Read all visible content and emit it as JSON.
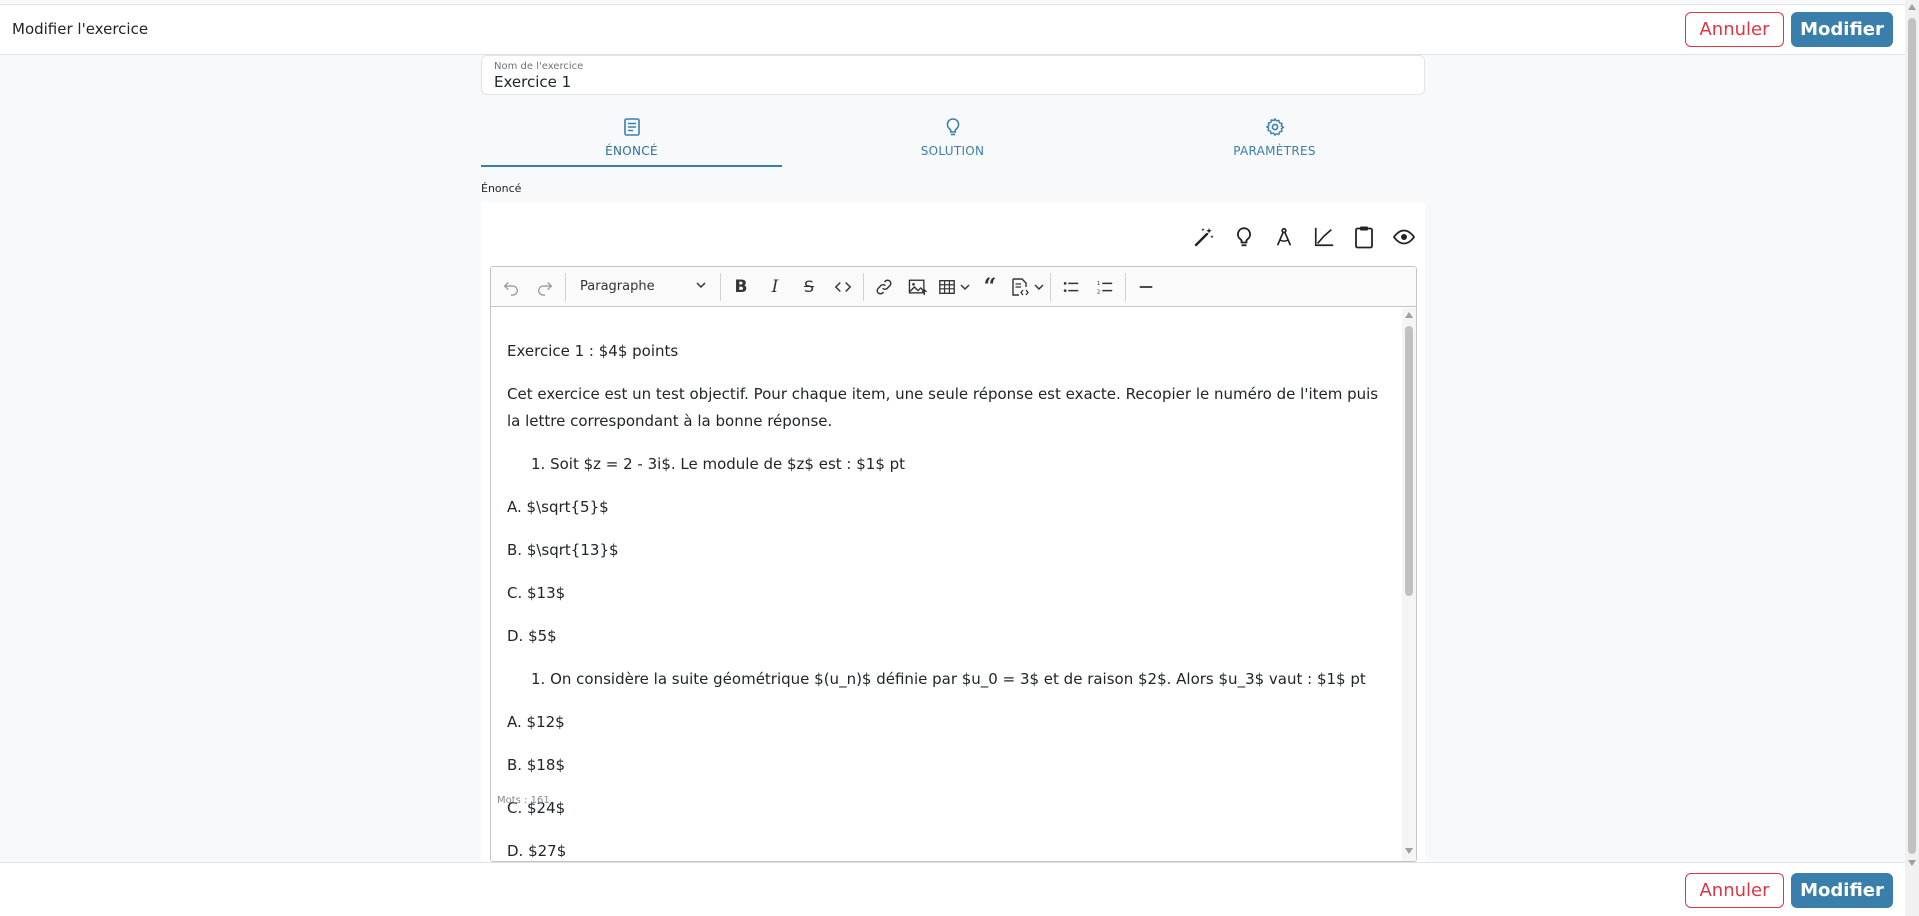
{
  "header": {
    "title": "Modifier l'exercice",
    "cancel_label": "Annuler",
    "submit_label": "Modifier"
  },
  "name_field": {
    "label": "Nom de l'exercice",
    "value": "Exercice 1"
  },
  "tabs": [
    {
      "label": "ÉNONCÉ",
      "icon": "document-icon",
      "active": true
    },
    {
      "label": "SOLUTION",
      "icon": "lightbulb-icon",
      "active": false
    },
    {
      "label": "PARAMÈTRES",
      "icon": "gear-icon",
      "active": false
    }
  ],
  "section_label": "Énoncé",
  "side_tools": [
    "magic-wand-icon",
    "lightbulb-icon",
    "compass-icon",
    "graph-icon",
    "clipboard-icon",
    "eye-icon"
  ],
  "editor": {
    "toolbar": {
      "heading_select": "Paragraphe"
    },
    "content": {
      "p1": "Exercice 1 : $4$ points",
      "p2": "Cet exercice est un test objectif. Pour chaque item, une seule réponse est exacte. Recopier le numéro de l'item puis la lettre correspondant à la bonne réponse.",
      "q1": "1. Soit $z = 2 - 3i$. Le module de $z$ est : $1$ pt",
      "q1a": "A. $\\sqrt{5}$",
      "q1b": "B. $\\sqrt{13}$",
      "q1c": "C. $13$",
      "q1d": "D. $5$",
      "q2": "1. On considère la suite géométrique $(u_n)$ définie par $u_0 = 3$ et de raison $2$. Alors $u_3$ vaut : $1$ pt",
      "q2a": "A. $12$",
      "q2b": "B. $18$",
      "q2c": "C. $24$",
      "q2d": "D. $27$"
    },
    "word_count": "Mots : 161"
  },
  "footer": {
    "cancel_label": "Annuler",
    "submit_label": "Modifier"
  },
  "colors": {
    "primary": "#3a7fab",
    "danger": "#dc3545"
  }
}
